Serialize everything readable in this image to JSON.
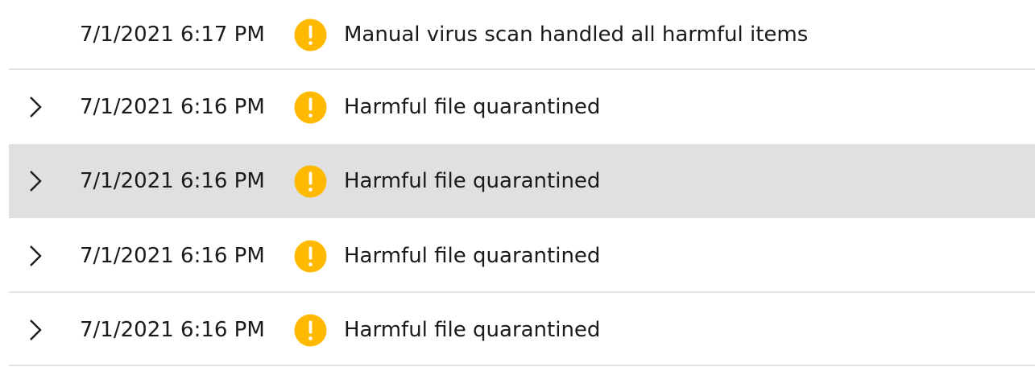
{
  "colors": {
    "warning_icon": "#ffb900",
    "selected_row": "#e0e0e0",
    "divider": "#e3e3e3"
  },
  "history": {
    "items": [
      {
        "timestamp": "7/1/2021 6:17 PM",
        "message": "Manual virus scan handled all harmful items",
        "icon": "warning-icon",
        "expandable": false,
        "selected": false
      },
      {
        "timestamp": "7/1/2021 6:16 PM",
        "message": "Harmful file quarantined",
        "icon": "warning-icon",
        "expandable": true,
        "selected": false
      },
      {
        "timestamp": "7/1/2021 6:16 PM",
        "message": "Harmful file quarantined",
        "icon": "warning-icon",
        "expandable": true,
        "selected": true
      },
      {
        "timestamp": "7/1/2021 6:16 PM",
        "message": "Harmful file quarantined",
        "icon": "warning-icon",
        "expandable": true,
        "selected": false
      },
      {
        "timestamp": "7/1/2021 6:16 PM",
        "message": "Harmful file quarantined",
        "icon": "warning-icon",
        "expandable": true,
        "selected": false
      }
    ]
  }
}
